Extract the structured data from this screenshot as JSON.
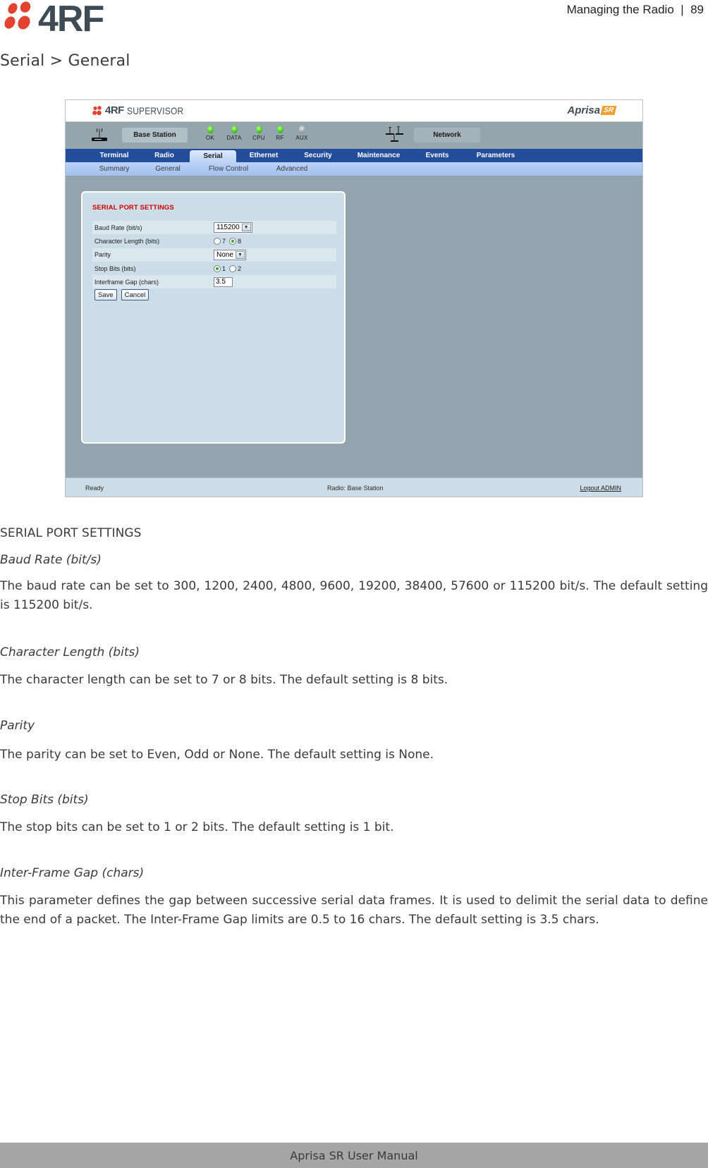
{
  "page": {
    "header_right": "Managing the Radio  |  89",
    "section_title": "Serial > General",
    "footer": "Aprisa SR User Manual"
  },
  "app": {
    "logo_text": "4RF",
    "product_name": "SUPERVISOR",
    "brand": "Aprisa",
    "brand_badge": "SR",
    "station_label": "Base Station",
    "network_label": "Network",
    "leds": [
      {
        "label": "OK",
        "state": "on"
      },
      {
        "label": "DATA",
        "state": "on"
      },
      {
        "label": "CPU",
        "state": "on"
      },
      {
        "label": "RF",
        "state": "on"
      },
      {
        "label": "AUX",
        "state": "off"
      }
    ],
    "main_tabs": [
      {
        "label": "Terminal",
        "active": false
      },
      {
        "label": "Radio",
        "active": false
      },
      {
        "label": "Serial",
        "active": true
      },
      {
        "label": "Ethernet",
        "active": false
      },
      {
        "label": "Security",
        "active": false
      },
      {
        "label": "Maintenance",
        "active": false
      },
      {
        "label": "Events",
        "active": false
      },
      {
        "label": "Parameters",
        "active": false
      }
    ],
    "sub_tabs": [
      {
        "label": "Summary",
        "active": false
      },
      {
        "label": "General",
        "active": true
      },
      {
        "label": "Flow Control",
        "active": false
      },
      {
        "label": "Advanced",
        "active": false
      }
    ],
    "panel": {
      "title": "SERIAL PORT SETTINGS",
      "rows": [
        {
          "label": "Baud Rate (bit/s)",
          "type": "select",
          "value": "115200"
        },
        {
          "label": "Character Length (bits)",
          "type": "radio",
          "options": [
            "7",
            "8"
          ],
          "selected": "8"
        },
        {
          "label": "Parity",
          "type": "select",
          "value": "None"
        },
        {
          "label": "Stop Bits (bits)",
          "type": "radio",
          "options": [
            "1",
            "2"
          ],
          "selected": "1"
        },
        {
          "label": "Interframe Gap (chars)",
          "type": "text",
          "value": "3.5"
        }
      ],
      "save_label": "Save",
      "cancel_label": "Cancel"
    },
    "status": {
      "left": "Ready",
      "center": "Radio: Base Station",
      "logout": "Logout ADMIN"
    },
    "colors": {
      "nav_blue": "#234c9a",
      "panel_title_red": "#cc0000",
      "led_green": "#3ec41b",
      "logo_red": "#e2422f"
    }
  },
  "doc": {
    "heading": "SERIAL PORT SETTINGS",
    "sections": [
      {
        "title": "Baud Rate (bit/s)",
        "text": "The baud rate can be set to 300, 1200, 2400, 4800, 9600, 19200, 38400, 57600 or 115200 bit/s. The default setting is 115200 bit/s."
      },
      {
        "title": "Character Length (bits)",
        "text": "The character length can be set to 7 or 8 bits. The default setting is 8 bits."
      },
      {
        "title": "Parity",
        "text": "The parity can be set to Even, Odd or None. The default setting is None."
      },
      {
        "title": "Stop Bits (bits)",
        "text": "The stop bits can be set to 1 or 2 bits. The default setting is 1 bit."
      },
      {
        "title": "Inter-Frame Gap (chars)",
        "text": "This parameter defines the gap between successive serial data frames. It is used to delimit the serial data to define the end of a packet. The Inter-Frame Gap limits are 0.5 to 16 chars. The default setting is 3.5 chars."
      }
    ]
  }
}
